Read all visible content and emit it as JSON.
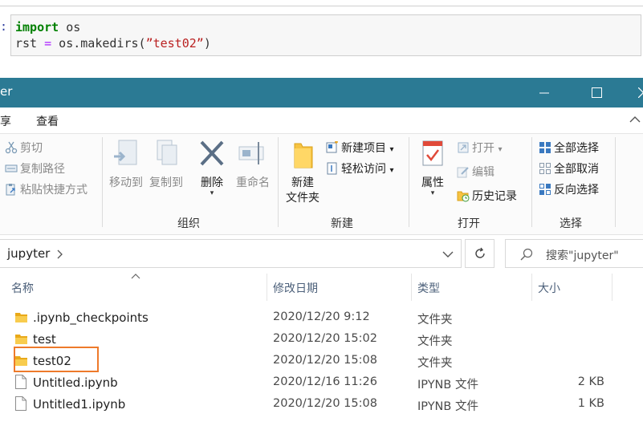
{
  "code": {
    "prompt": ":",
    "line1": {
      "kw": "import",
      "rest": " os"
    },
    "line2": {
      "a": "rst ",
      "op": "=",
      "b": " os.makedirs(",
      "str": "”test02”",
      "c": ")"
    }
  },
  "window": {
    "title_fragment": "er",
    "minimize": "—",
    "maximize": "☐",
    "close": "✕"
  },
  "ribbon_tabs": [
    "享",
    "查看"
  ],
  "ribbon": {
    "clipboard": {
      "cut": "剪切",
      "copy_path": "复制路径",
      "paste_shortcut": "粘贴快捷方式"
    },
    "organize": {
      "label": "组织",
      "move_to": "移动到",
      "copy_to": "复制到",
      "delete": "删除",
      "rename": "重命名"
    },
    "new": {
      "label": "新建",
      "new_folder_line1": "新建",
      "new_folder_line2": "文件夹",
      "new_item": "新建项目",
      "easy_access": "轻松访问"
    },
    "open": {
      "label": "打开",
      "properties": "属性",
      "open": "打开",
      "edit": "编辑",
      "history": "历史记录"
    },
    "select": {
      "label": "选择",
      "select_all": "全部选择",
      "select_none": "全部取消",
      "invert": "反向选择"
    }
  },
  "address": {
    "path": "jupyter",
    "search_placeholder": "搜索\"jupyter\""
  },
  "columns": {
    "name": "名称",
    "modified": "修改日期",
    "type": "类型",
    "size": "大小"
  },
  "files": [
    {
      "name": ".ipynb_checkpoints",
      "modified": "2020/12/20 9:12",
      "type": "文件夹",
      "size": "",
      "kind": "folder"
    },
    {
      "name": "test",
      "modified": "2020/12/20 15:02",
      "type": "文件夹",
      "size": "",
      "kind": "folder"
    },
    {
      "name": "test02",
      "modified": "2020/12/20 15:08",
      "type": "文件夹",
      "size": "",
      "kind": "folder",
      "highlighted": true
    },
    {
      "name": "Untitled.ipynb",
      "modified": "2020/12/16 11:26",
      "type": "IPYNB 文件",
      "size": "2 KB",
      "kind": "file"
    },
    {
      "name": "Untitled1.ipynb",
      "modified": "2020/12/20 15:08",
      "type": "IPYNB 文件",
      "size": "1 KB",
      "kind": "file"
    }
  ],
  "colors": {
    "titlebar": "#2b7a94",
    "highlight": "#ee7a2b",
    "folder": "#f6c342"
  }
}
